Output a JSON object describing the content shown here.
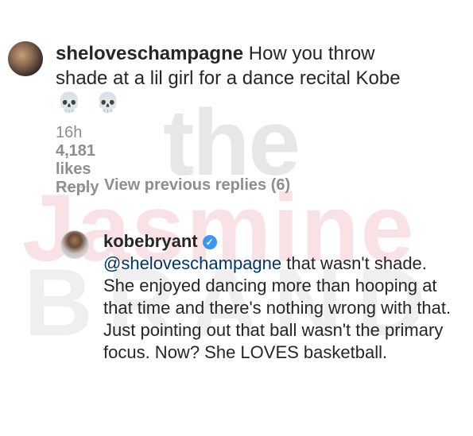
{
  "watermark": {
    "line1": "the",
    "line2": "Jasmine",
    "line3": "BRAND"
  },
  "comment": {
    "username": "sheloveschampagne",
    "text": "How you throw shade at a lil girl for a dance recital Kobe",
    "emoji": "💀 💀",
    "time": "16h",
    "likes": "4,181 likes",
    "reply_label": "Reply"
  },
  "replies_toggle": "View previous replies (6)",
  "reply": {
    "username": "kobebryant",
    "verified_icon": "verified-badge-icon",
    "mention": "@sheloveschampagne",
    "text": " that wasn't shade. She enjoyed dancing more than hooping at that time and there's nothing wrong with that. Just pointing out that ball wasn't the primary focus. Now? She LOVES basketball."
  },
  "colors": {
    "verified": "#3897f0",
    "meta": "#8e8e8e",
    "text": "#262626"
  }
}
